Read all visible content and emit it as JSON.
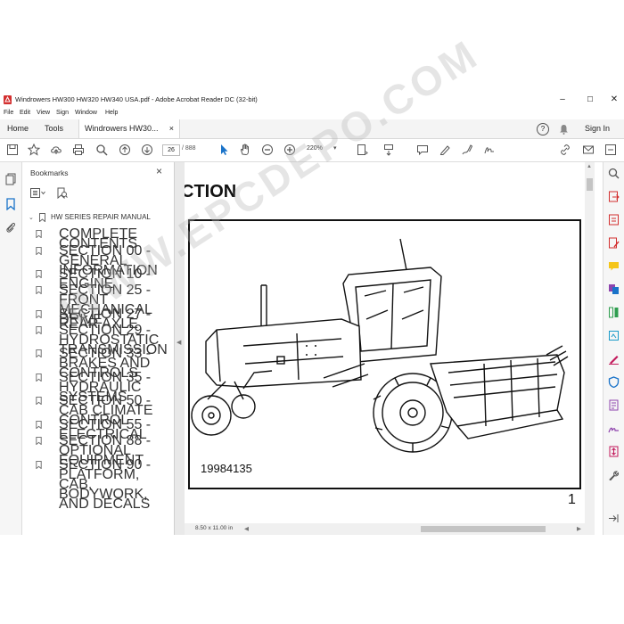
{
  "window": {
    "title": "Windrowers HW300 HW320 HW340 USA.pdf - Adobe Acrobat Reader DC (32-bit)",
    "controls": [
      "–",
      "☐",
      "✕"
    ]
  },
  "menu": [
    "File",
    "Edit",
    "View",
    "Sign",
    "Window",
    "Help"
  ],
  "tabs": {
    "home": "Home",
    "tools": "Tools",
    "document": "Windrowers HW30...",
    "document_close": "×",
    "help_icon": "?",
    "sign_in": "Sign In"
  },
  "toolbar": {
    "page_current": "26",
    "page_total": "/ 888",
    "zoom": "220%"
  },
  "bookmarks": {
    "title": "Bookmarks",
    "close": "×",
    "root": "HW SERIES REPAIR MANUAL",
    "items": [
      "COMPLETE CONTENTS",
      "SECTION 00 - GENERAL INFORMATION",
      "SECTION 10 - ENGINE",
      "SECTION 25 - FRONT MECHANICAL DRIVE",
      "SECTION 27 - REAR AXLE",
      "SECTION 29 - HYDROSTATIC TRANSMISSION",
      "SECTION 33 - BRAKES AND CONTROLS",
      "SECTION 35 - HYDRAULIC SYSTEMS",
      "SECTION 50 - CAB CLIMATE CONTROL",
      "SECTION 55 - ELECTRICAL",
      "SECTION 88 - OPTIONAL EQUIPMENT",
      "SECTION 90 - PLATFORM, CAB, BODYWORK, AND DECALS"
    ]
  },
  "document": {
    "heading": "CTION",
    "figure_number": "19984135",
    "figure_label": "1",
    "page_size": "8.50 x 11.00 in"
  },
  "watermark": "WWW.EPCDEPO.COM",
  "colors": {
    "accent_blue": "#1a73c9",
    "pdf_red": "#d32f2f",
    "rail_bg": "#f6f6f6"
  }
}
